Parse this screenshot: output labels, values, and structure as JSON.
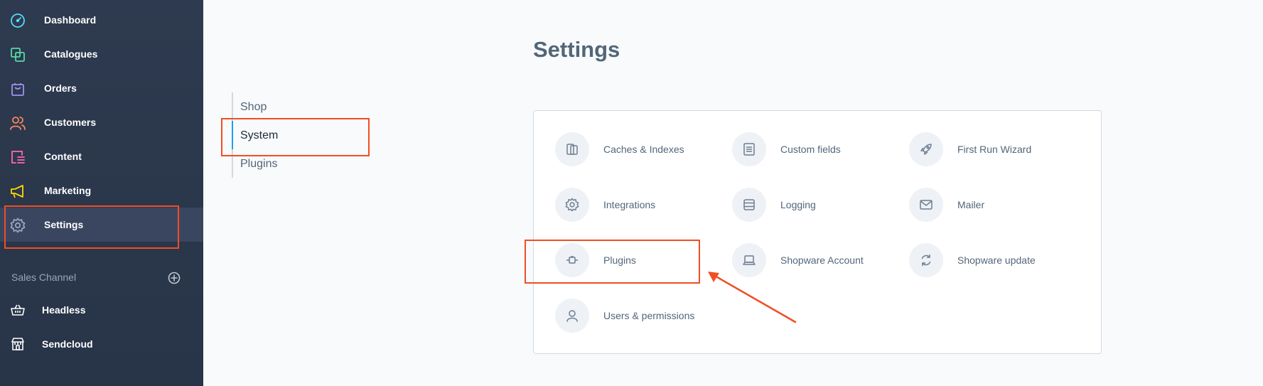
{
  "sidebar": {
    "items": [
      {
        "label": "Dashboard",
        "icon": "gauge-icon",
        "color": "#57d9f5"
      },
      {
        "label": "Catalogues",
        "icon": "copy-icon",
        "color": "#57d9a3"
      },
      {
        "label": "Orders",
        "icon": "shopping-bag-icon",
        "color": "#a092f0"
      },
      {
        "label": "Customers",
        "icon": "users-icon",
        "color": "#f88962"
      },
      {
        "label": "Content",
        "icon": "content-icon",
        "color": "#ff68b4"
      },
      {
        "label": "Marketing",
        "icon": "megaphone-icon",
        "color": "#ffd700"
      },
      {
        "label": "Settings",
        "icon": "gear-icon",
        "color": "#9aa6b8"
      }
    ],
    "sales_channel": {
      "title": "Sales Channel",
      "items": [
        {
          "label": "Headless",
          "icon": "basket-icon"
        },
        {
          "label": "Sendcloud",
          "icon": "storefront-icon"
        }
      ]
    }
  },
  "subnav": {
    "items": [
      "Shop",
      "System",
      "Plugins"
    ],
    "active": "System"
  },
  "page": {
    "title": "Settings"
  },
  "settings_tiles": [
    {
      "label": "Caches & Indexes",
      "icon": "cache-icon"
    },
    {
      "label": "Custom fields",
      "icon": "list-document-icon"
    },
    {
      "label": "First Run Wizard",
      "icon": "rocket-icon"
    },
    {
      "label": "Integrations",
      "icon": "gear-icon"
    },
    {
      "label": "Logging",
      "icon": "server-icon"
    },
    {
      "label": "Mailer",
      "icon": "envelope-icon"
    },
    {
      "label": "Plugins",
      "icon": "plug-icon"
    },
    {
      "label": "Shopware Account",
      "icon": "laptop-icon"
    },
    {
      "label": "Shopware update",
      "icon": "refresh-icon"
    },
    {
      "label": "Users & permissions",
      "icon": "user-icon"
    }
  ],
  "colors": {
    "sidebar_bg": "#2e3a4f",
    "highlight": "#f04e23",
    "accent": "#189eff",
    "text": "#52667a"
  }
}
